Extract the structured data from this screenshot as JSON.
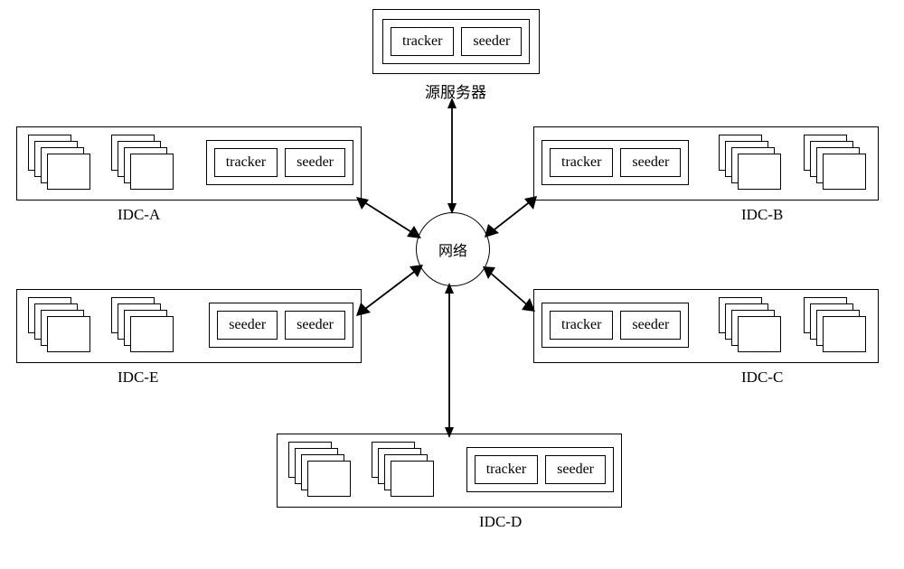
{
  "source_server": {
    "tracker": "tracker",
    "seeder": "seeder",
    "label": "源服务器"
  },
  "network": {
    "label": "网络"
  },
  "nodes": {
    "A": {
      "label": "IDC-A",
      "left_box": "tracker",
      "right_box": "seeder"
    },
    "B": {
      "label": "IDC-B",
      "left_box": "tracker",
      "right_box": "seeder"
    },
    "C": {
      "label": "IDC-C",
      "left_box": "tracker",
      "right_box": "seeder"
    },
    "D": {
      "label": "IDC-D",
      "left_box": "tracker",
      "right_box": "seeder"
    },
    "E": {
      "label": "IDC-E",
      "left_box": "seeder",
      "right_box": "seeder"
    }
  }
}
